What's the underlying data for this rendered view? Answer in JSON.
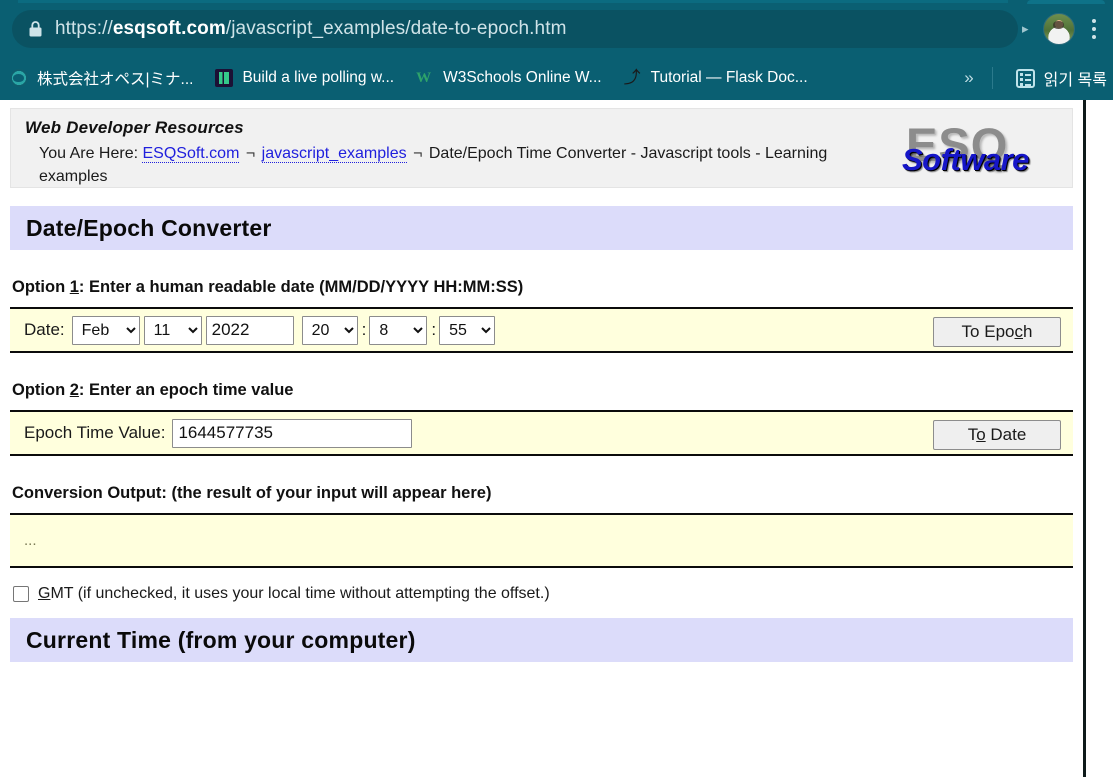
{
  "browser": {
    "url_prefix": "https://",
    "url_host": "esqsoft.com",
    "url_path": "/javascript_examples/date-to-epoch.htm",
    "lock_icon": "lock-icon",
    "avatar_icon": "avatar",
    "menu_icon": "kebab-menu-icon",
    "share_caret": "▸",
    "bookmarks": [
      {
        "label": "株式会社オペス|ミナ...",
        "icon": "opus-favicon"
      },
      {
        "label": "Build a live polling w...",
        "icon": "polling-favicon"
      },
      {
        "label": "W3Schools Online W...",
        "icon": "w3schools-favicon",
        "glyph": "W"
      },
      {
        "label": "Tutorial — Flask Doc...",
        "icon": "flask-favicon",
        "glyph": "⤴"
      }
    ],
    "overflow_label": "»",
    "reading_list_label": "읽기 목록",
    "reading_list_icon": "reading-list-icon"
  },
  "page": {
    "site_title": "Web Developer Resources",
    "breadcrumb": {
      "prefix": "You Are Here:",
      "link1": "ESQSoft.com",
      "sep1": "¬",
      "link2": "javascript_examples",
      "sep2": "¬",
      "tail": "Date/Epoch Time Converter - Javascript tools - Learning examples"
    },
    "logo": {
      "top": "ESQ",
      "bottom": "Software"
    },
    "converter_banner": "Date/Epoch Converter",
    "option1": {
      "label_prefix": "Option ",
      "label_key": "1",
      "label_suffix": ": Enter a human readable date (MM/DD/YYYY HH:MM:SS)",
      "date_label": "Date:",
      "month": "Feb",
      "day": "11",
      "year": "2022",
      "hour": "20",
      "minute": "8",
      "second": "55",
      "colon": ":",
      "button_pre": "To Epo",
      "button_key": "c",
      "button_post": "h"
    },
    "option2": {
      "label_prefix": "Option ",
      "label_key": "2",
      "label_suffix": ": Enter an epoch time value",
      "field_label": "Epoch Time Value:",
      "epoch_value": "1644577735",
      "button_pre": "T",
      "button_key": "o",
      "button_post": " Date"
    },
    "output": {
      "label": "Conversion Output: (the result of your input will appear here)",
      "value": "..."
    },
    "gmt": {
      "checked": false,
      "label_pre": "",
      "label_key": "G",
      "label_post": "MT (if unchecked, it uses your local time without attempting the offset.)"
    },
    "current_time_banner": "Current Time (from your computer)"
  },
  "colors": {
    "chrome_teal": "#0a5f72",
    "omnibox": "#0a5262",
    "banner_lavender": "#dcdcfa",
    "row_yellow": "#ffffdd",
    "link_blue": "#2020dd",
    "logo_blue": "#1616c8"
  }
}
